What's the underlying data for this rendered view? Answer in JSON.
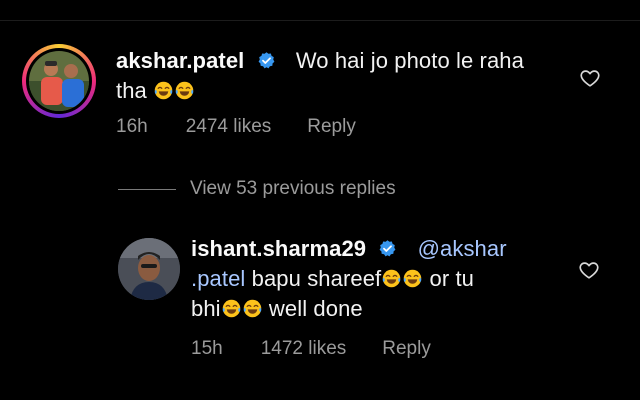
{
  "colors": {
    "background": "#000000",
    "text": "#f2f2f2",
    "meta": "#9b9b9b",
    "mention": "#a8c7ff",
    "verified": "#3797f0"
  },
  "comment": {
    "username": "akshar.patel",
    "verified": true,
    "text_line1": "Wo hai  jo photo le raha",
    "text_line2": "tha",
    "emoji": "face-with-tears-of-joy",
    "time": "16h",
    "likes": "2474 likes",
    "reply_label": "Reply",
    "has_story_ring": true
  },
  "view_replies": {
    "label": "View 53 previous replies"
  },
  "reply": {
    "username": "ishant.sharma29",
    "verified": true,
    "mention_part1": "@akshar",
    "mention_part2": ".patel",
    "text_a": " bapu shareef",
    "text_b": " or tu",
    "text_c": "bhi",
    "text_d": " well done",
    "time": "15h",
    "likes": "1472 likes",
    "reply_label": "Reply"
  },
  "icons": {
    "like": "heart-outline-icon",
    "verified": "verified-badge-icon"
  }
}
